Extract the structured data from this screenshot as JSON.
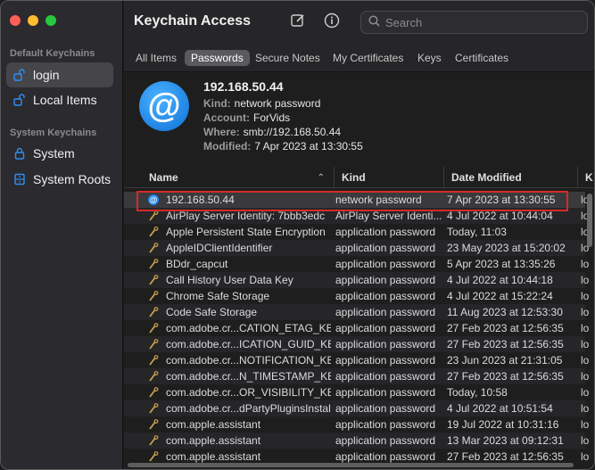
{
  "window": {
    "title": "Keychain Access",
    "search_placeholder": "Search"
  },
  "sidebar": {
    "default_header": "Default Keychains",
    "system_header": "System Keychains",
    "items": [
      {
        "label": "login",
        "icon": "unlock-icon",
        "selected": true
      },
      {
        "label": "Local Items",
        "icon": "unlock-icon",
        "selected": false
      },
      {
        "label": "System",
        "icon": "lock-icon",
        "selected": false
      },
      {
        "label": "System Roots",
        "icon": "cabinet-icon",
        "selected": false
      }
    ]
  },
  "tabs": [
    "All Items",
    "Passwords",
    "Secure Notes",
    "My Certificates",
    "Keys",
    "Certificates"
  ],
  "active_tab": "Passwords",
  "detail": {
    "title": "192.168.50.44",
    "kind_label": "Kind:",
    "kind": "network password",
    "account_label": "Account:",
    "account": "ForVids",
    "where_label": "Where:",
    "where": "smb://192.168.50.44",
    "modified_label": "Modified:",
    "modified": "7 Apr 2023 at 13:30:55"
  },
  "table": {
    "columns": {
      "name": "Name",
      "kind": "Kind",
      "date": "Date Modified",
      "extra": "K"
    },
    "rows": [
      {
        "name": "192.168.50.44",
        "kind": "network password",
        "date": "7 Apr 2023 at 13:30:55",
        "extra": "lo",
        "icon": "at-icon"
      },
      {
        "name": "AirPlay Server Identity: 7bbb3edc",
        "kind": "AirPlay Server Identi...",
        "date": "4 Jul 2022 at 10:44:04",
        "extra": "lo",
        "icon": "key-icon"
      },
      {
        "name": "Apple Persistent State Encryption",
        "kind": "application password",
        "date": "Today, 11:03",
        "extra": "lo",
        "icon": "key-icon"
      },
      {
        "name": "AppleIDClientIdentifier",
        "kind": "application password",
        "date": "23 May 2023 at 15:20:02",
        "extra": "lo",
        "icon": "key-icon"
      },
      {
        "name": "BDdr_capcut",
        "kind": "application password",
        "date": "5 Apr 2023 at 13:35:26",
        "extra": "lo",
        "icon": "key-icon"
      },
      {
        "name": "Call History User Data Key",
        "kind": "application password",
        "date": "4 Jul 2022 at 10:44:18",
        "extra": "lo",
        "icon": "key-icon"
      },
      {
        "name": "Chrome Safe Storage",
        "kind": "application password",
        "date": "4 Jul 2022 at 15:22:24",
        "extra": "lo",
        "icon": "key-icon"
      },
      {
        "name": "Code Safe Storage",
        "kind": "application password",
        "date": "11 Aug 2023 at 12:53:30",
        "extra": "lo",
        "icon": "key-icon"
      },
      {
        "name": "com.adobe.cr...CATION_ETAG_KEY",
        "kind": "application password",
        "date": "27 Feb 2023 at 12:56:35",
        "extra": "lo",
        "icon": "key-icon"
      },
      {
        "name": "com.adobe.cr...ICATION_GUID_KEY",
        "kind": "application password",
        "date": "27 Feb 2023 at 12:56:35",
        "extra": "lo",
        "icon": "key-icon"
      },
      {
        "name": "com.adobe.cr...NOTIFICATION_KEY",
        "kind": "application password",
        "date": "23 Jun 2023 at 21:31:05",
        "extra": "lo",
        "icon": "key-icon"
      },
      {
        "name": "com.adobe.cr...N_TIMESTAMP_KEY",
        "kind": "application password",
        "date": "27 Feb 2023 at 12:56:35",
        "extra": "lo",
        "icon": "key-icon"
      },
      {
        "name": "com.adobe.cr...OR_VISIBILITY_KEY",
        "kind": "application password",
        "date": "Today, 10:58",
        "extra": "lo",
        "icon": "key-icon"
      },
      {
        "name": "com.adobe.cr...dPartyPluginsInstall",
        "kind": "application password",
        "date": "4 Jul 2022 at 10:51:54",
        "extra": "lo",
        "icon": "key-icon"
      },
      {
        "name": "com.apple.assistant",
        "kind": "application password",
        "date": "19 Jul 2022 at 10:31:16",
        "extra": "lo",
        "icon": "key-icon"
      },
      {
        "name": "com.apple.assistant",
        "kind": "application password",
        "date": "13 Mar 2023 at 09:12:31",
        "extra": "lo",
        "icon": "key-icon"
      },
      {
        "name": "com.apple.assistant",
        "kind": "application password",
        "date": "27 Feb 2023 at 12:56:35",
        "extra": "lo",
        "icon": "key-icon"
      }
    ]
  },
  "colors": {
    "accent": "#1c86ee",
    "highlight": "#d42a2a"
  }
}
